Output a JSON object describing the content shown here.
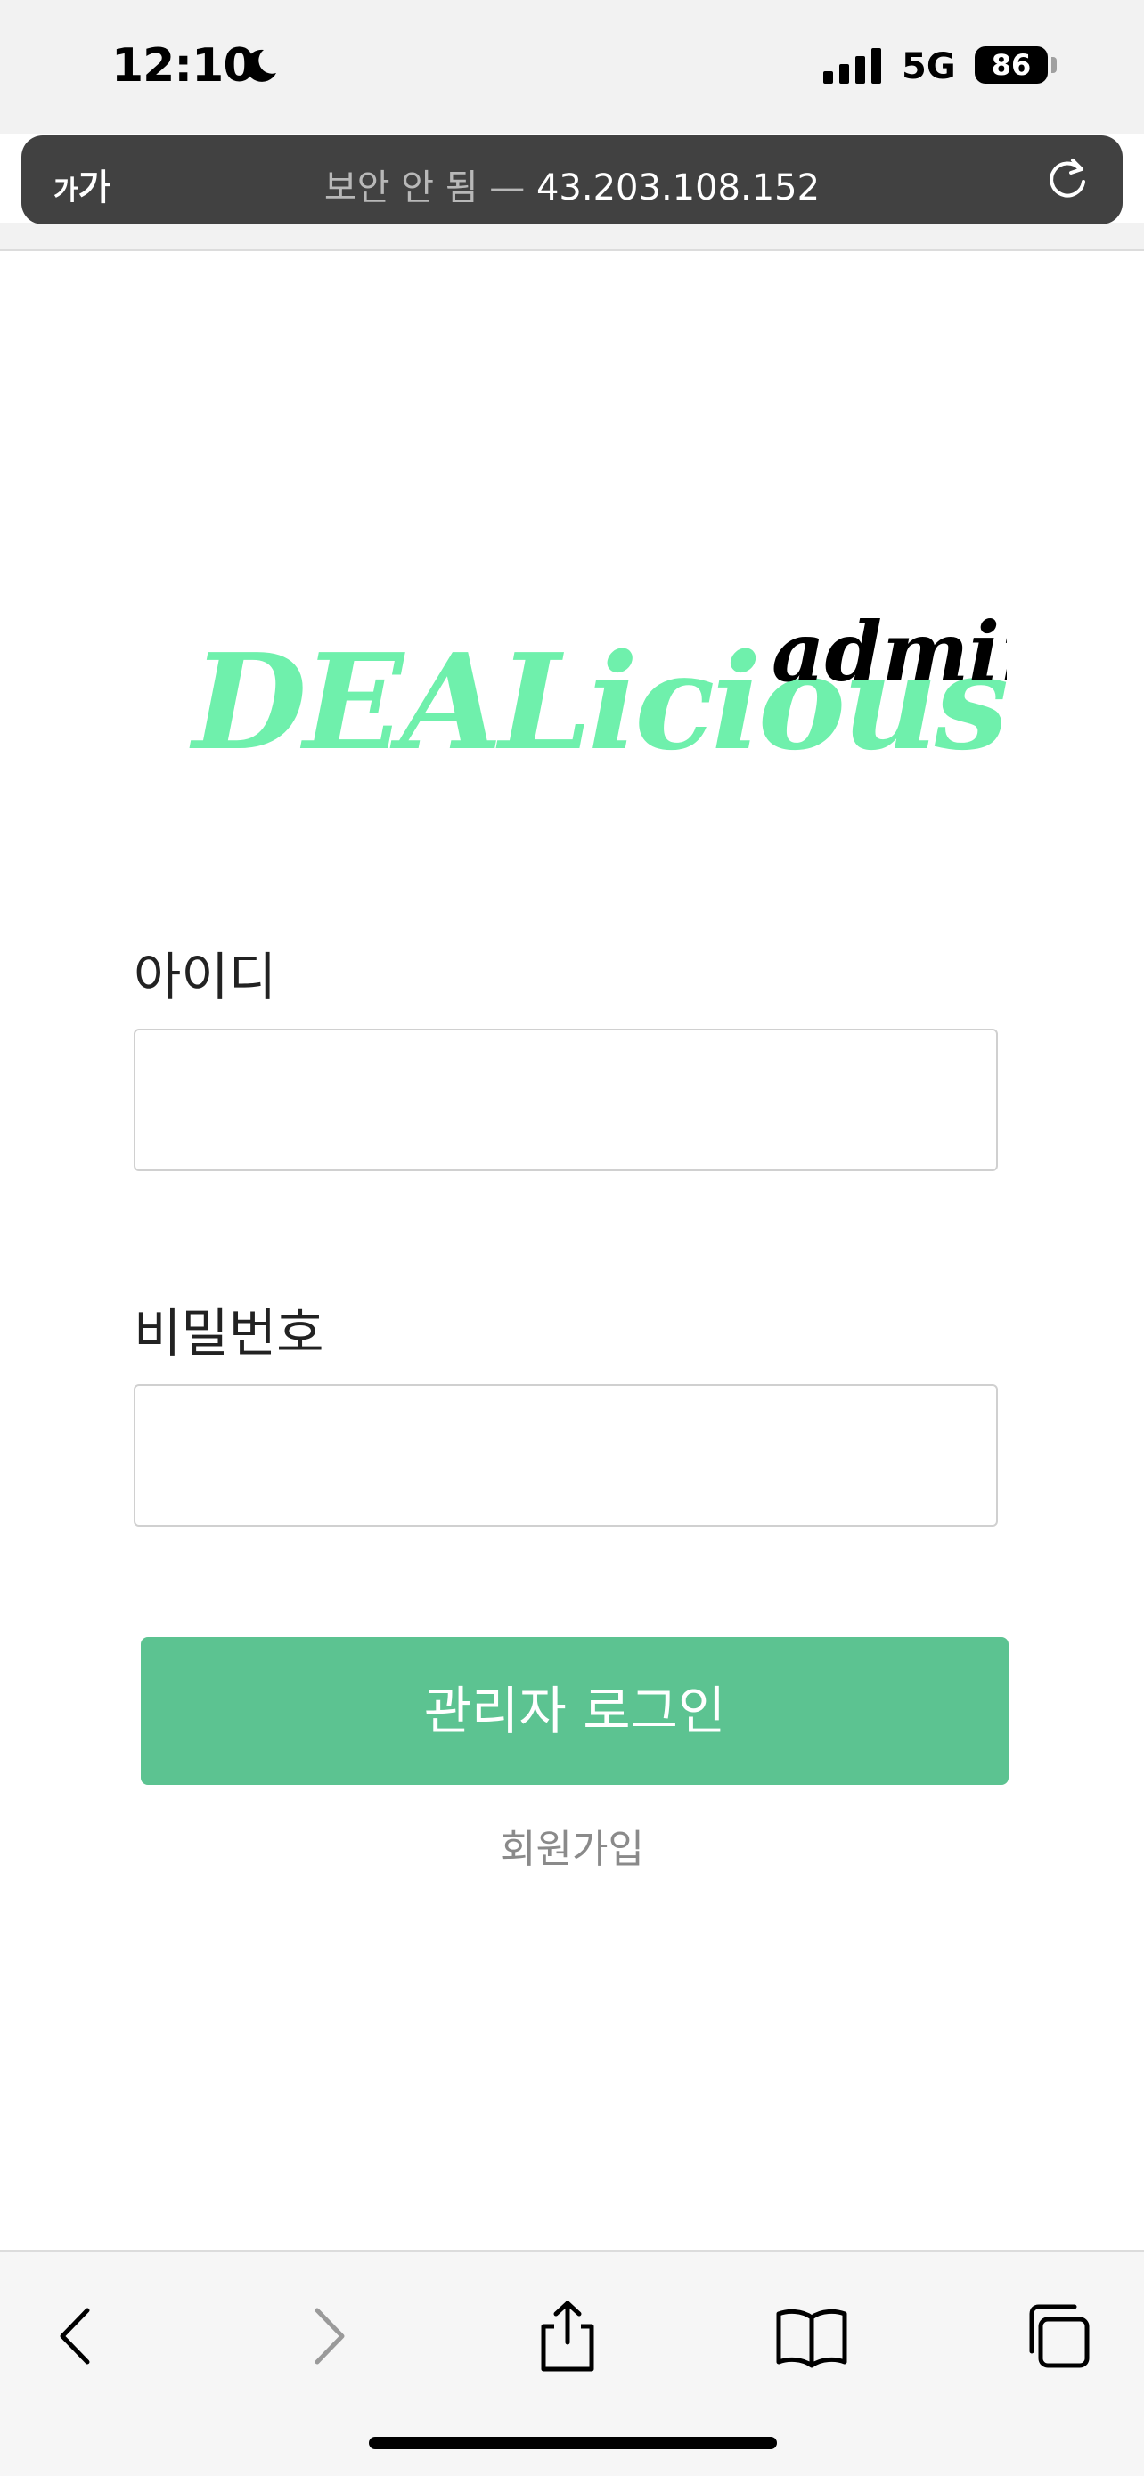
{
  "status_bar": {
    "time": "12:10",
    "network": "5G",
    "battery": "86"
  },
  "url_bar": {
    "text_size_label_small": "가",
    "text_size_label_large": "가",
    "insecure_label": "보안 안 됨",
    "separator": " — ",
    "address": "43.203.108.152"
  },
  "logo": {
    "main": "DEALicious",
    "badge": "admin",
    "main_color": "#6ff0ac",
    "badge_color": "#000000"
  },
  "form": {
    "id_label": "아이디",
    "id_value": "",
    "password_label": "비밀번호",
    "password_value": "",
    "login_button": "관리자 로그인",
    "signup_link": "회원가입",
    "accent_color": "#5cc391"
  },
  "toolbar": {
    "icons": [
      "back-icon",
      "forward-icon",
      "share-icon",
      "bookmarks-icon",
      "tabs-icon"
    ]
  }
}
